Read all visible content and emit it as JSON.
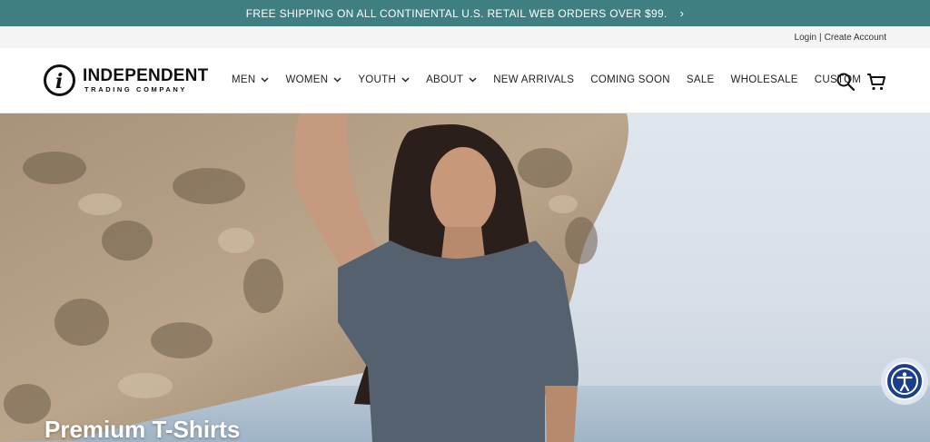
{
  "promo": {
    "text": "FREE SHIPPING ON ALL CONTINENTAL U.S. RETAIL WEB ORDERS OVER $99.",
    "arrow": "›"
  },
  "account": {
    "login": "Login",
    "separator": "|",
    "create": "Create Account"
  },
  "brand": {
    "line1": "INDEPENDENT",
    "line2": "TRADING COMPANY",
    "mark": "i"
  },
  "nav": {
    "items": [
      {
        "label": "MEN",
        "dropdown": "⌄"
      },
      {
        "label": "WOMEN",
        "dropdown": "⌄"
      },
      {
        "label": "YOUTH",
        "dropdown": "⌄"
      },
      {
        "label": "ABOUT",
        "dropdown": "⌄"
      },
      {
        "label": "NEW ARRIVALS"
      },
      {
        "label": "COMING SOON"
      },
      {
        "label": "SALE"
      },
      {
        "label": "WHOLESALE"
      },
      {
        "label": "CUSTOM"
      }
    ]
  },
  "header_icons": [
    "search-icon",
    "cart-icon"
  ],
  "hero": {
    "title": "Premium T-Shirts"
  },
  "accessibility": {
    "icon": "accessibility-icon"
  },
  "colors": {
    "promo_bar": "#3f7f82",
    "accessibility": "#1b3f8f"
  }
}
